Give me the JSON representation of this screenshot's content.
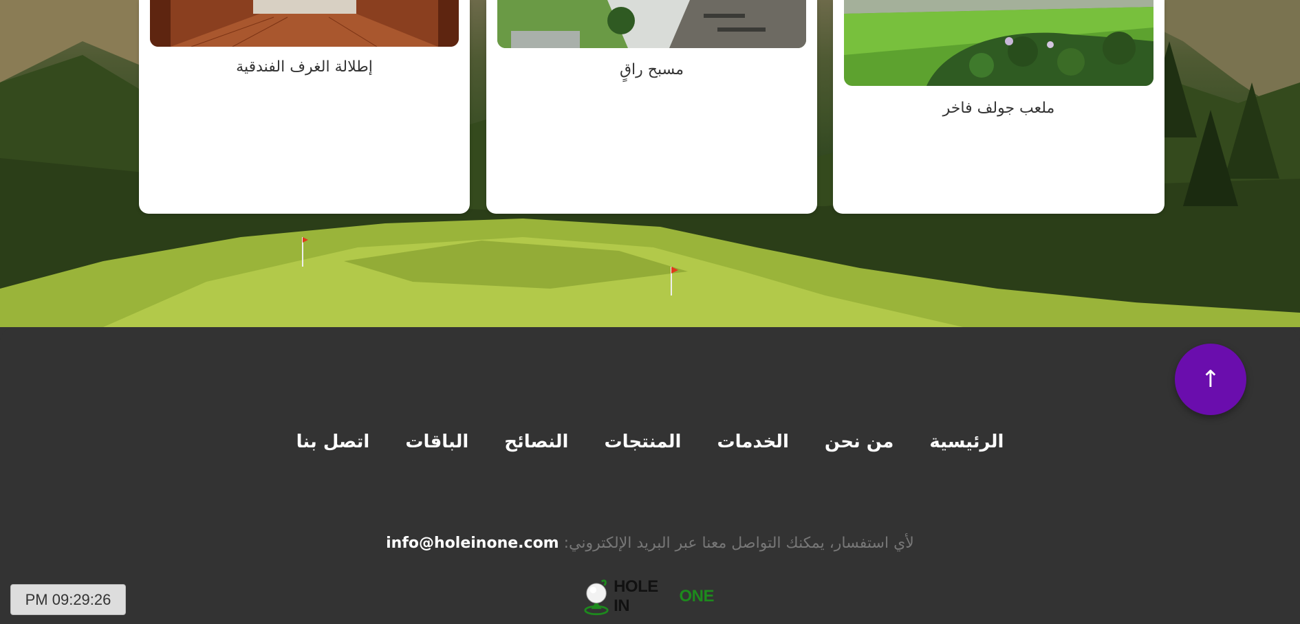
{
  "cards": [
    {
      "caption": "إطلالة الغرف الفندقية"
    },
    {
      "caption": "مسبح راقٍ"
    },
    {
      "caption": "ملعب جولف فاخر"
    }
  ],
  "scroll_top": {
    "symbol": "↑"
  },
  "footer": {
    "nav": [
      {
        "label": "الرئيسية"
      },
      {
        "label": "من نحن"
      },
      {
        "label": "الخدمات"
      },
      {
        "label": "المنتجات"
      },
      {
        "label": "النصائح"
      },
      {
        "label": "الباقات"
      },
      {
        "label": "اتصل بنا"
      }
    ],
    "contact_text": "لأي استفسار، يمكنك التواصل معنا عبر البريد الإلكتروني:",
    "email": "info@holeinone.com",
    "logo_word1": "HOLE IN",
    "logo_word2": "ONE"
  },
  "clock": {
    "time": "PM 09:29:26"
  },
  "colors": {
    "footer_bg": "#333333",
    "accent_purple": "#6a0dad",
    "logo_green": "#1d8a1d"
  }
}
